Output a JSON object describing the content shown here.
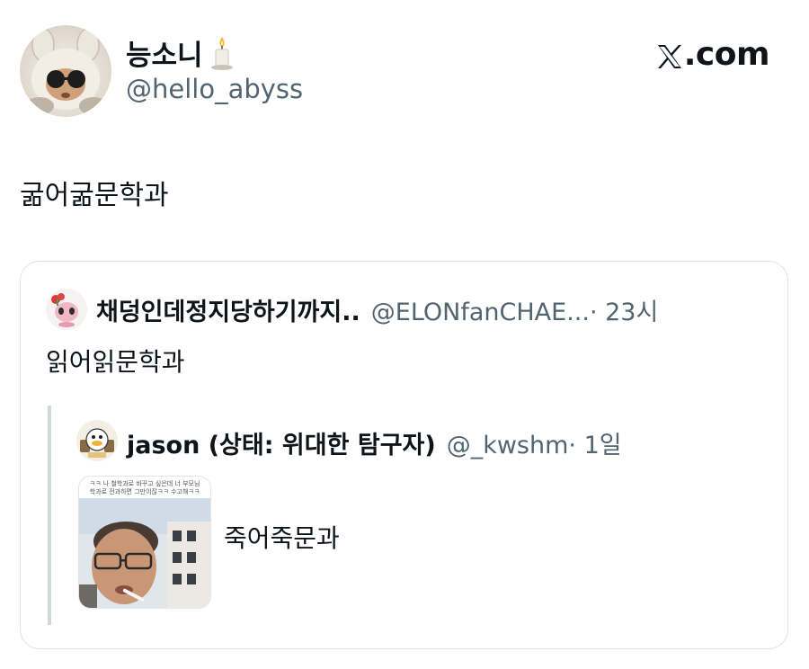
{
  "header": {
    "display_name": "능소니",
    "handle": "@hello_abyss",
    "brand": ".com"
  },
  "tweet": {
    "text": "굶어굶문학과"
  },
  "quote": {
    "name": "채덩인데정지당하기까지..",
    "handle": "@ELONfanCHAE...",
    "time": " · 23시",
    "text": "읽어읽문학과",
    "nested": {
      "name": "jason (상태: 위대한 탐구자)",
      "handle": "@_kwshm",
      "time": " · 1일",
      "text": "죽어죽문과",
      "media_caption_line1": "ㅋㅋ 나 철학과로 바꾸고 싶은데 너 부모님",
      "media_caption_line2": "학과로 전과하면 그만이잖ㅋㅋ 수고해ㅋㅋ"
    }
  },
  "icons": {
    "candle": "candle-icon",
    "x_logo": "x-logo-icon"
  },
  "colors": {
    "text": "#0f1419",
    "secondary": "#536471",
    "border": "#dfe3e6",
    "thread_line": "#cfd9de"
  }
}
